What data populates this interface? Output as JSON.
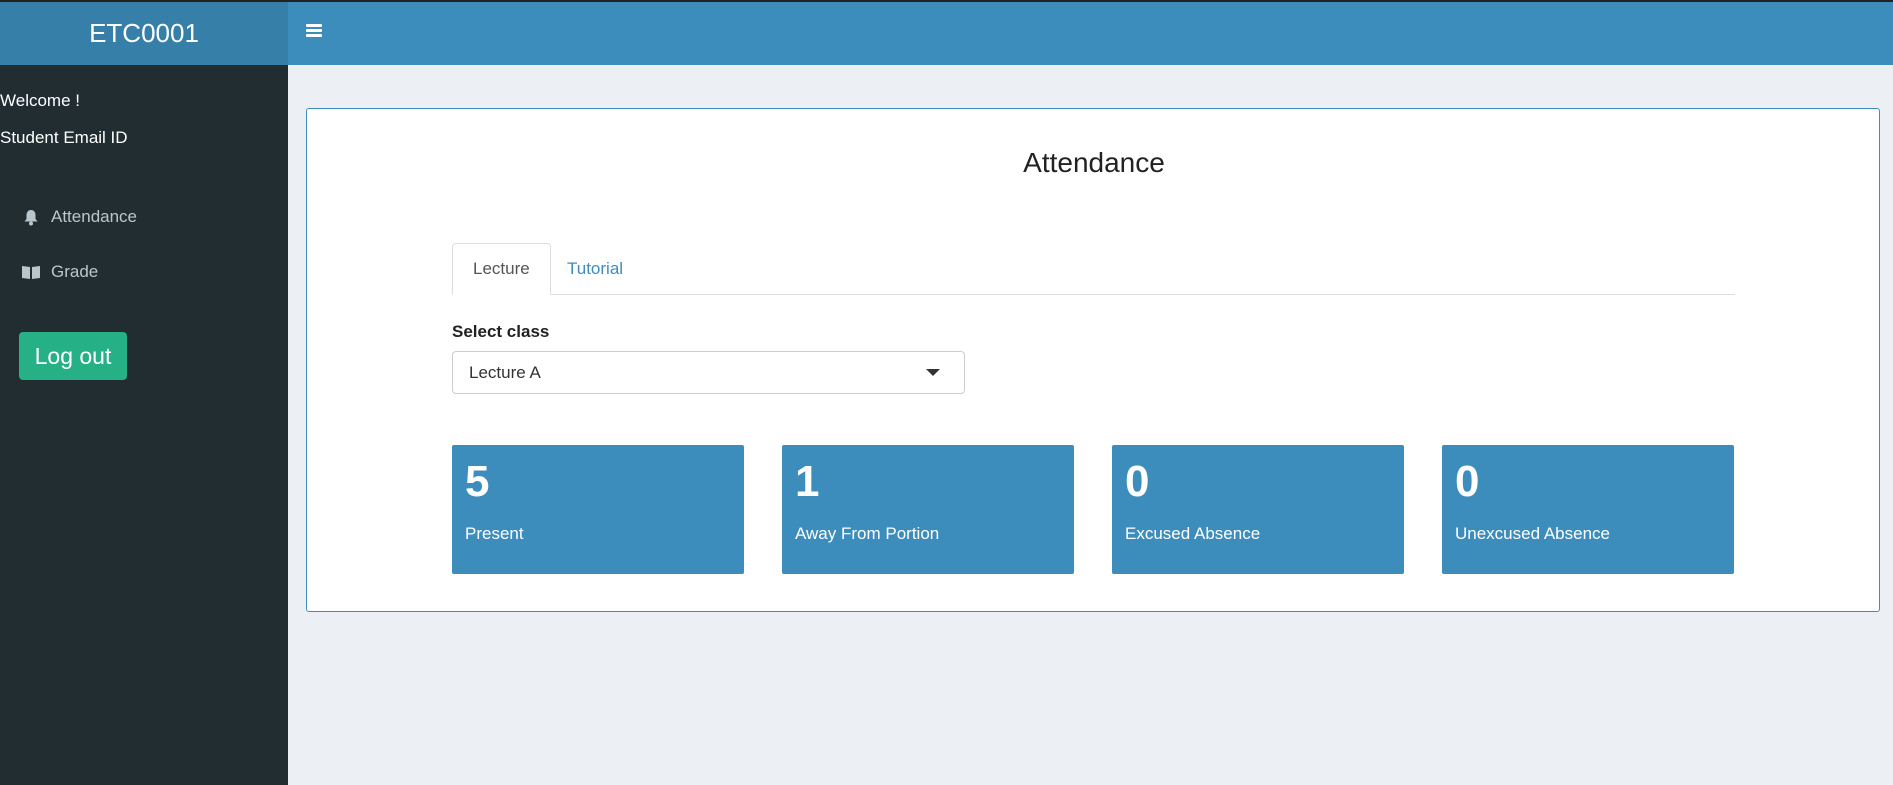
{
  "app": {
    "title": "ETC0001"
  },
  "sidebar": {
    "welcome": "Welcome !",
    "email_label": "Student Email ID",
    "items": [
      {
        "label": "Attendance",
        "icon": "bell-icon"
      },
      {
        "label": "Grade",
        "icon": "book-icon"
      }
    ],
    "logout_label": "Log out"
  },
  "main": {
    "title": "Attendance",
    "tabs": [
      {
        "label": "Lecture",
        "active": true
      },
      {
        "label": "Tutorial",
        "active": false
      }
    ],
    "select": {
      "label": "Select class",
      "value": "Lecture A"
    },
    "stats": [
      {
        "value": "5",
        "label": "Present"
      },
      {
        "value": "1",
        "label": "Away From Portion"
      },
      {
        "value": "0",
        "label": "Excused Absence"
      },
      {
        "value": "0",
        "label": "Unexcused Absence"
      }
    ]
  },
  "colors": {
    "brand": "#367fa9",
    "navbar": "#3c8dbc",
    "sidebar": "#222d32",
    "logout": "#26b085",
    "stat_box": "#3c8dbc",
    "background": "#ecf0f5"
  }
}
